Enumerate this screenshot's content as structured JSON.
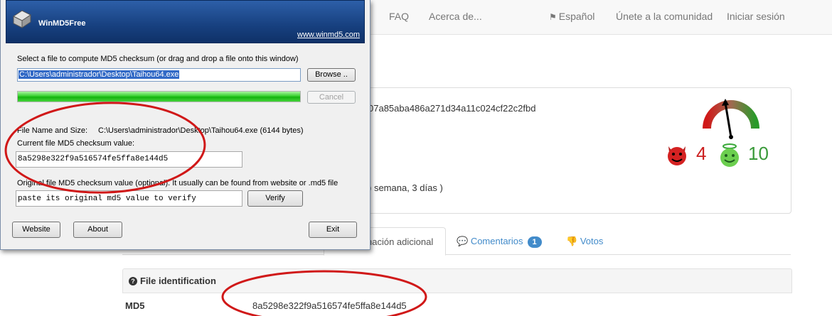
{
  "nav": {
    "faq": "FAQ",
    "about": "Acerca de...",
    "language": "Español",
    "community": "Únete a la comunidad",
    "login": "Iniciar sesión"
  },
  "file_summary": {
    "hash_fragment": "07a85aba486a271d34a11c024cf22c2fbd",
    "age_fragment": ") semana, 3 días )",
    "bad_votes": "4",
    "good_votes": "10"
  },
  "tabs": {
    "info_partial": "nación adicional",
    "comments": "Comentarios",
    "comments_count": "1",
    "votes": "Votos"
  },
  "file_identification": {
    "title": "File identification",
    "md5_label": "MD5",
    "md5_value": "8a5298e322f9a516574fe5ffa8e144d5"
  },
  "app": {
    "title": "WinMD5Free",
    "url": "www.winmd5.com",
    "select_prompt": "Select a file to compute MD5 checksum (or drag and drop a file onto this window)",
    "file_path": "C:\\Users\\administrador\\Desktop\\Taihou64.exe",
    "browse_label": "Browse ..",
    "cancel_label": "Cancel",
    "progress_fraction": 1.0,
    "file_name_size_label": "File Name and Size:",
    "file_name_size_value": "C:\\Users\\administrador\\Desktop\\Taihou64.exe (6144 bytes)",
    "current_checksum_label": "Current file MD5 checksum value:",
    "current_checksum_value": "8a5298e322f9a516574fe5ffa8e144d5",
    "original_checksum_label": "Original file MD5 checksum value (optional). It usually can be found from website or .md5 file",
    "original_checksum_placeholder": "paste its original md5 value to verify",
    "verify_label": "Verify",
    "website_label": "Website",
    "about_label": "About",
    "exit_label": "Exit"
  },
  "colors": {
    "annotation_red": "#d01818",
    "link_blue": "#428bca",
    "bad_red": "#cc2020",
    "good_green": "#3a9a3a"
  }
}
